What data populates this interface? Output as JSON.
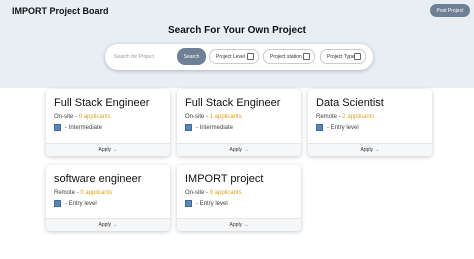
{
  "header": {
    "brand": "IMPORT Project Board",
    "post_button": "Post Project",
    "headline": "Search For Your Own Project"
  },
  "search": {
    "placeholder": "Search for Project",
    "button": "Search",
    "filters": [
      "Project Level",
      "Project station",
      "Project Type"
    ]
  },
  "cards": [
    {
      "title": "Full Stack Engineer",
      "location": "On-site",
      "applicants": "0 applicants",
      "level": "Intermediate",
      "apply": "Apply →"
    },
    {
      "title": "Full Stack Engineer",
      "location": "On-site",
      "applicants": "1 applicants",
      "level": "Intermediate",
      "apply": "Apply →"
    },
    {
      "title": "Data Scientist",
      "location": "Remote",
      "applicants": "2 applicants",
      "level": "Entry level",
      "apply": "Apply →"
    },
    {
      "title": "software engineer",
      "location": "Remote",
      "applicants": "0 applicants",
      "level": "Entry level",
      "apply": "Apply →"
    },
    {
      "title": "IMPORT project",
      "location": "On-site",
      "applicants": "0 applicants",
      "level": "Entry level",
      "apply": "Apply →"
    }
  ]
}
